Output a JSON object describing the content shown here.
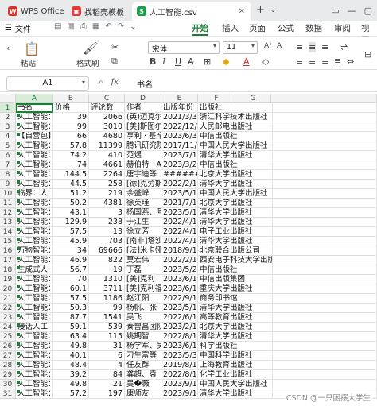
{
  "tabs": [
    {
      "label": "WPS Office",
      "icon": "wps-logo-icon",
      "color": "#d93025"
    },
    {
      "label": "找稻壳模板",
      "icon": "docer-logo-icon",
      "color": "#e53935"
    },
    {
      "label": "人工智能.csv",
      "icon": "spreadsheet-s-icon",
      "color": "#1a9d4a"
    }
  ],
  "menu": {
    "file": "文件",
    "ribbon_tabs": [
      "开始",
      "插入",
      "页面",
      "公式",
      "数据",
      "审阅",
      "视图"
    ],
    "active_tab": "开始"
  },
  "toolbar": {
    "format_painter": "格式刷",
    "paste": "粘贴",
    "font": "宋体",
    "size": "11"
  },
  "formula_bar": {
    "name_box": "A1",
    "fx": "fx",
    "content": "书名"
  },
  "columns": [
    "A",
    "B",
    "C",
    "D",
    "E",
    "F",
    "G"
  ],
  "rows": [
    [
      "书名",
      "价格",
      "评论数",
      "作者",
      "出版年份",
      "出版社"
    ],
    [
      "人工智能：",
      "39",
      "2066",
      "(英)迈克尔",
      "2021/3/31",
      "浙江科学技术出版社"
    ],
    [
      "人工智能：",
      "99",
      "3010",
      "[美]斯图尔",
      "2022/12/1",
      "人民邮电出版社"
    ],
    [
      "【自营包】",
      "66",
      "4680",
      "亨利 · 基辛",
      "2023/6/30",
      "中信出版社"
    ],
    [
      "人工智能：",
      "57.8",
      "11399",
      "腾讯研究院",
      "2017/11/1",
      "中国人民大学出版社"
    ],
    [
      "人工智能：",
      "74.2",
      "410",
      "范煜",
      "2023/7/1",
      "清华大学出版社"
    ],
    [
      "人工智能：",
      "74",
      "4661",
      "赫伯特 · A.",
      "2023/3/23",
      "中信出版社"
    ],
    [
      "人工智能：",
      "144.5",
      "2264",
      "唐宇迪等",
      "########",
      "北京大学出版社"
    ],
    [
      "人工智能：",
      "44.5",
      "258",
      "[德]克劳斯",
      "2022/2/1",
      "清华大学出版社"
    ],
    [
      "临界：人",
      "51.2",
      "219",
      "余盛峰",
      "2023/5/1",
      "中国人民大学出版社"
    ],
    [
      "人工智能：",
      "50.2",
      "4381",
      "徐英瑾",
      "2021/7/1",
      "北京大学出版社"
    ],
    [
      "人工智能：",
      "43.1",
      "3",
      "杨国燕、号",
      "2023/5/1",
      "清华大学出版社"
    ],
    [
      "人工智能：",
      "129.9",
      "238",
      "于江生",
      "2022/4/1",
      "清华大学出版社"
    ],
    [
      "人工智能：",
      "57.5",
      "13",
      "徐立芳",
      "2022/4/1",
      "电子工业出版社"
    ],
    [
      "人工智能：",
      "45.9",
      "703",
      "[南非]塔沙",
      "2022/4/1",
      "清华大学出版社"
    ],
    [
      "万物智能：",
      "34",
      "69666",
      "[法]米卡娅",
      "2018/9/1",
      "北京联合出版公司"
    ],
    [
      "人工智能：",
      "46.9",
      "822",
      "莫宏伟",
      "2022/2/1",
      "西安电子科技大学出版社"
    ],
    [
      "生成式人",
      "56.7",
      "19",
      "丁磊",
      "2023/5/2",
      "中信出版社"
    ],
    [
      "人工智能：",
      "70",
      "1310",
      "[美]克利",
      "2023/6/1",
      "中信出版集团"
    ],
    [
      "人工智能：",
      "60.1",
      "3711",
      "[美]克利福",
      "2023/6/1",
      "重庆大学出版社"
    ],
    [
      "人工智能：",
      "57.5",
      "1186",
      "赵江阳",
      "2022/9/1",
      "商务印书馆"
    ],
    [
      "人工智能：",
      "50.3",
      "99",
      "杨帆、张",
      "2023/5/1",
      "清华大学出版社"
    ],
    [
      "人工智能：",
      "87.7",
      "1541",
      "吴飞",
      "2022/6/1",
      "高等教育出版社"
    ],
    [
      "漫话人工",
      "59.1",
      "539",
      "秦曾昌团队",
      "2023/2/1",
      "北京大学出版社"
    ],
    [
      "人工智能：",
      "63.4",
      "115",
      "姚期智",
      "2022/8/1",
      "清华大学出版社"
    ],
    [
      "人工智能：",
      "49.8",
      "31",
      "杨学军、吴",
      "2023/6/1",
      "科学出版社"
    ],
    [
      "人工智能：",
      "40.1",
      "6",
      "刁生富等",
      "2023/5/31",
      "中国科学出版社"
    ],
    [
      "人工智能：",
      "48.4",
      "4",
      "任友群",
      "2019/8/1",
      "上海教育出版社"
    ],
    [
      "人工智能：",
      "39.2",
      "84",
      "龚超、袁",
      "2022/8/1",
      "化学工业出版社"
    ],
    [
      "人工智能：",
      "49.8",
      "21",
      "吴�薇",
      "2023/9/15",
      "中国人民大学出版社"
    ],
    [
      "人工智能：",
      "57.2",
      "197",
      "康师友",
      "2023/9/1",
      "清华大学出版社"
    ]
  ],
  "watermark": "CSDN @一只困摆大学生"
}
